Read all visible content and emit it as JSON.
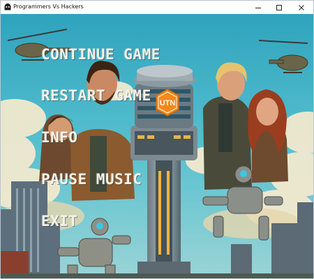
{
  "window": {
    "title": "Programmers Vs Hackers",
    "minimize_icon": "minimize-icon",
    "maximize_icon": "maximize-icon",
    "close_icon": "close-icon"
  },
  "menu": {
    "items": [
      {
        "label": "CONTINUE GAME"
      },
      {
        "label": "RESTART GAME"
      },
      {
        "label": "INFO"
      },
      {
        "label": "PAUSE MUSIC"
      },
      {
        "label": "EXIT"
      }
    ]
  },
  "scene": {
    "tower_badge": "UTN",
    "colors": {
      "sky": "#3fb2c6",
      "clouds": "#f2e9cf",
      "badge": "#f08a1c",
      "menu_text": "#f4f1e8"
    }
  }
}
